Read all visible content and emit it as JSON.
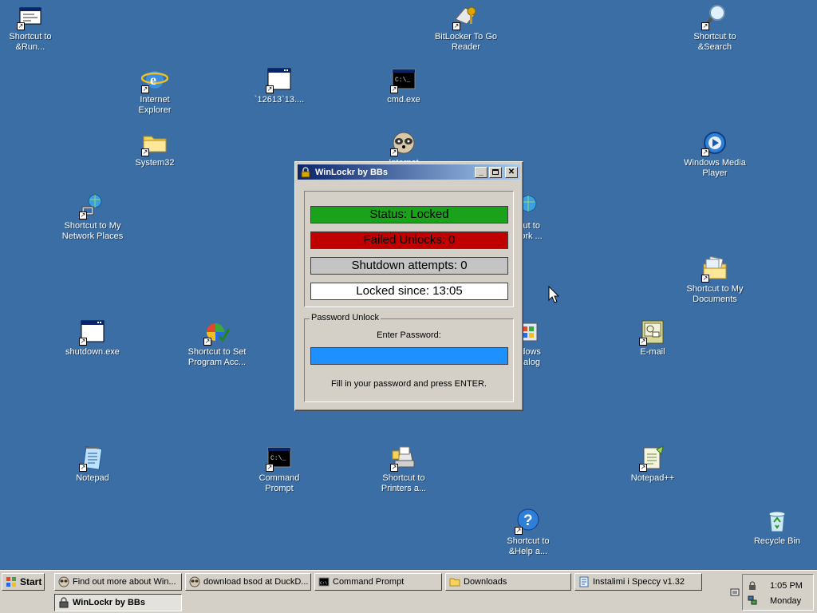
{
  "desktop": {
    "icons": [
      {
        "id": "run",
        "label": "Shortcut to\n&Run...",
        "icon": "run-icon"
      },
      {
        "id": "bitlocker",
        "label": "BitLocker To Go\nReader",
        "icon": "bitlocker-icon"
      },
      {
        "id": "search",
        "label": "Shortcut to\n&Search",
        "icon": "search-icon"
      },
      {
        "id": "ie",
        "label": "Internet\nExplorer",
        "icon": "internet-explorer-icon"
      },
      {
        "id": "12613",
        "label": "`12613`13....",
        "icon": "window-app-icon"
      },
      {
        "id": "cmdexe",
        "label": "cmd.exe",
        "icon": "console-icon"
      },
      {
        "id": "system32",
        "label": "System32",
        "icon": "folder-icon"
      },
      {
        "id": "internet",
        "label": "Internet",
        "icon": "raccoon-icon"
      },
      {
        "id": "wmp",
        "label": "Windows Media\nPlayer",
        "icon": "media-player-icon"
      },
      {
        "id": "network",
        "label": "Shortcut to My\nNetwork Places",
        "icon": "network-icon"
      },
      {
        "id": "network2",
        "label": "tcut to\nwork ...",
        "icon": "network-globe-icon"
      },
      {
        "id": "mydocs",
        "label": "Shortcut to My\nDocuments",
        "icon": "documents-icon"
      },
      {
        "id": "shutdown",
        "label": "shutdown.exe",
        "icon": "window-app-icon"
      },
      {
        "id": "setprog",
        "label": "Shortcut to Set\nProgram Acc...",
        "icon": "program-access-icon"
      },
      {
        "id": "catalog",
        "label": "ndows\natalog",
        "icon": "windows-catalog-icon"
      },
      {
        "id": "email",
        "label": "E-mail",
        "icon": "email-icon"
      },
      {
        "id": "notepad",
        "label": "Notepad",
        "icon": "notepad-icon"
      },
      {
        "id": "cmdprompt",
        "label": "Command\nPrompt",
        "icon": "console-icon"
      },
      {
        "id": "printers",
        "label": "Shortcut to\nPrinters a...",
        "icon": "printer-icon"
      },
      {
        "id": "notepadpp",
        "label": "Notepad++",
        "icon": "notepad-plus-icon"
      },
      {
        "id": "help",
        "label": "Shortcut to\n&Help a...",
        "icon": "help-icon"
      },
      {
        "id": "recycle",
        "label": "Recycle Bin",
        "icon": "recycle-bin-icon"
      }
    ]
  },
  "window": {
    "title": "WinLockr by BBs",
    "status": {
      "label": "Status: Locked",
      "color": "#1aa31a"
    },
    "failed": {
      "label": "Failed Unlocks: 0",
      "color": "#c00000"
    },
    "shutdown": {
      "label": "Shutdown attempts: 0",
      "color": "#c4c4c4"
    },
    "locked_since": {
      "label": "Locked since: 13:05",
      "color": "#ffffff"
    },
    "unlock_group": {
      "legend": "Password Unlock",
      "prompt": "Enter Password:",
      "value": "",
      "hint": "Fill in your password and press ENTER."
    }
  },
  "taskbar": {
    "start_label": "Start",
    "items": [
      {
        "label": "Find out more about Win...",
        "icon": "raccoon-icon"
      },
      {
        "label": "download bsod at DuckD...",
        "icon": "raccoon-icon"
      },
      {
        "label": "Command Prompt",
        "icon": "console-icon"
      },
      {
        "label": "Downloads",
        "icon": "folder-icon"
      },
      {
        "label": "Instalimi i Speccy v1.32",
        "icon": "installer-icon"
      },
      {
        "label": "WinLockr by BBs",
        "icon": "lock-icon"
      }
    ],
    "clock": {
      "time": "1:05 PM",
      "day": "Monday"
    }
  }
}
